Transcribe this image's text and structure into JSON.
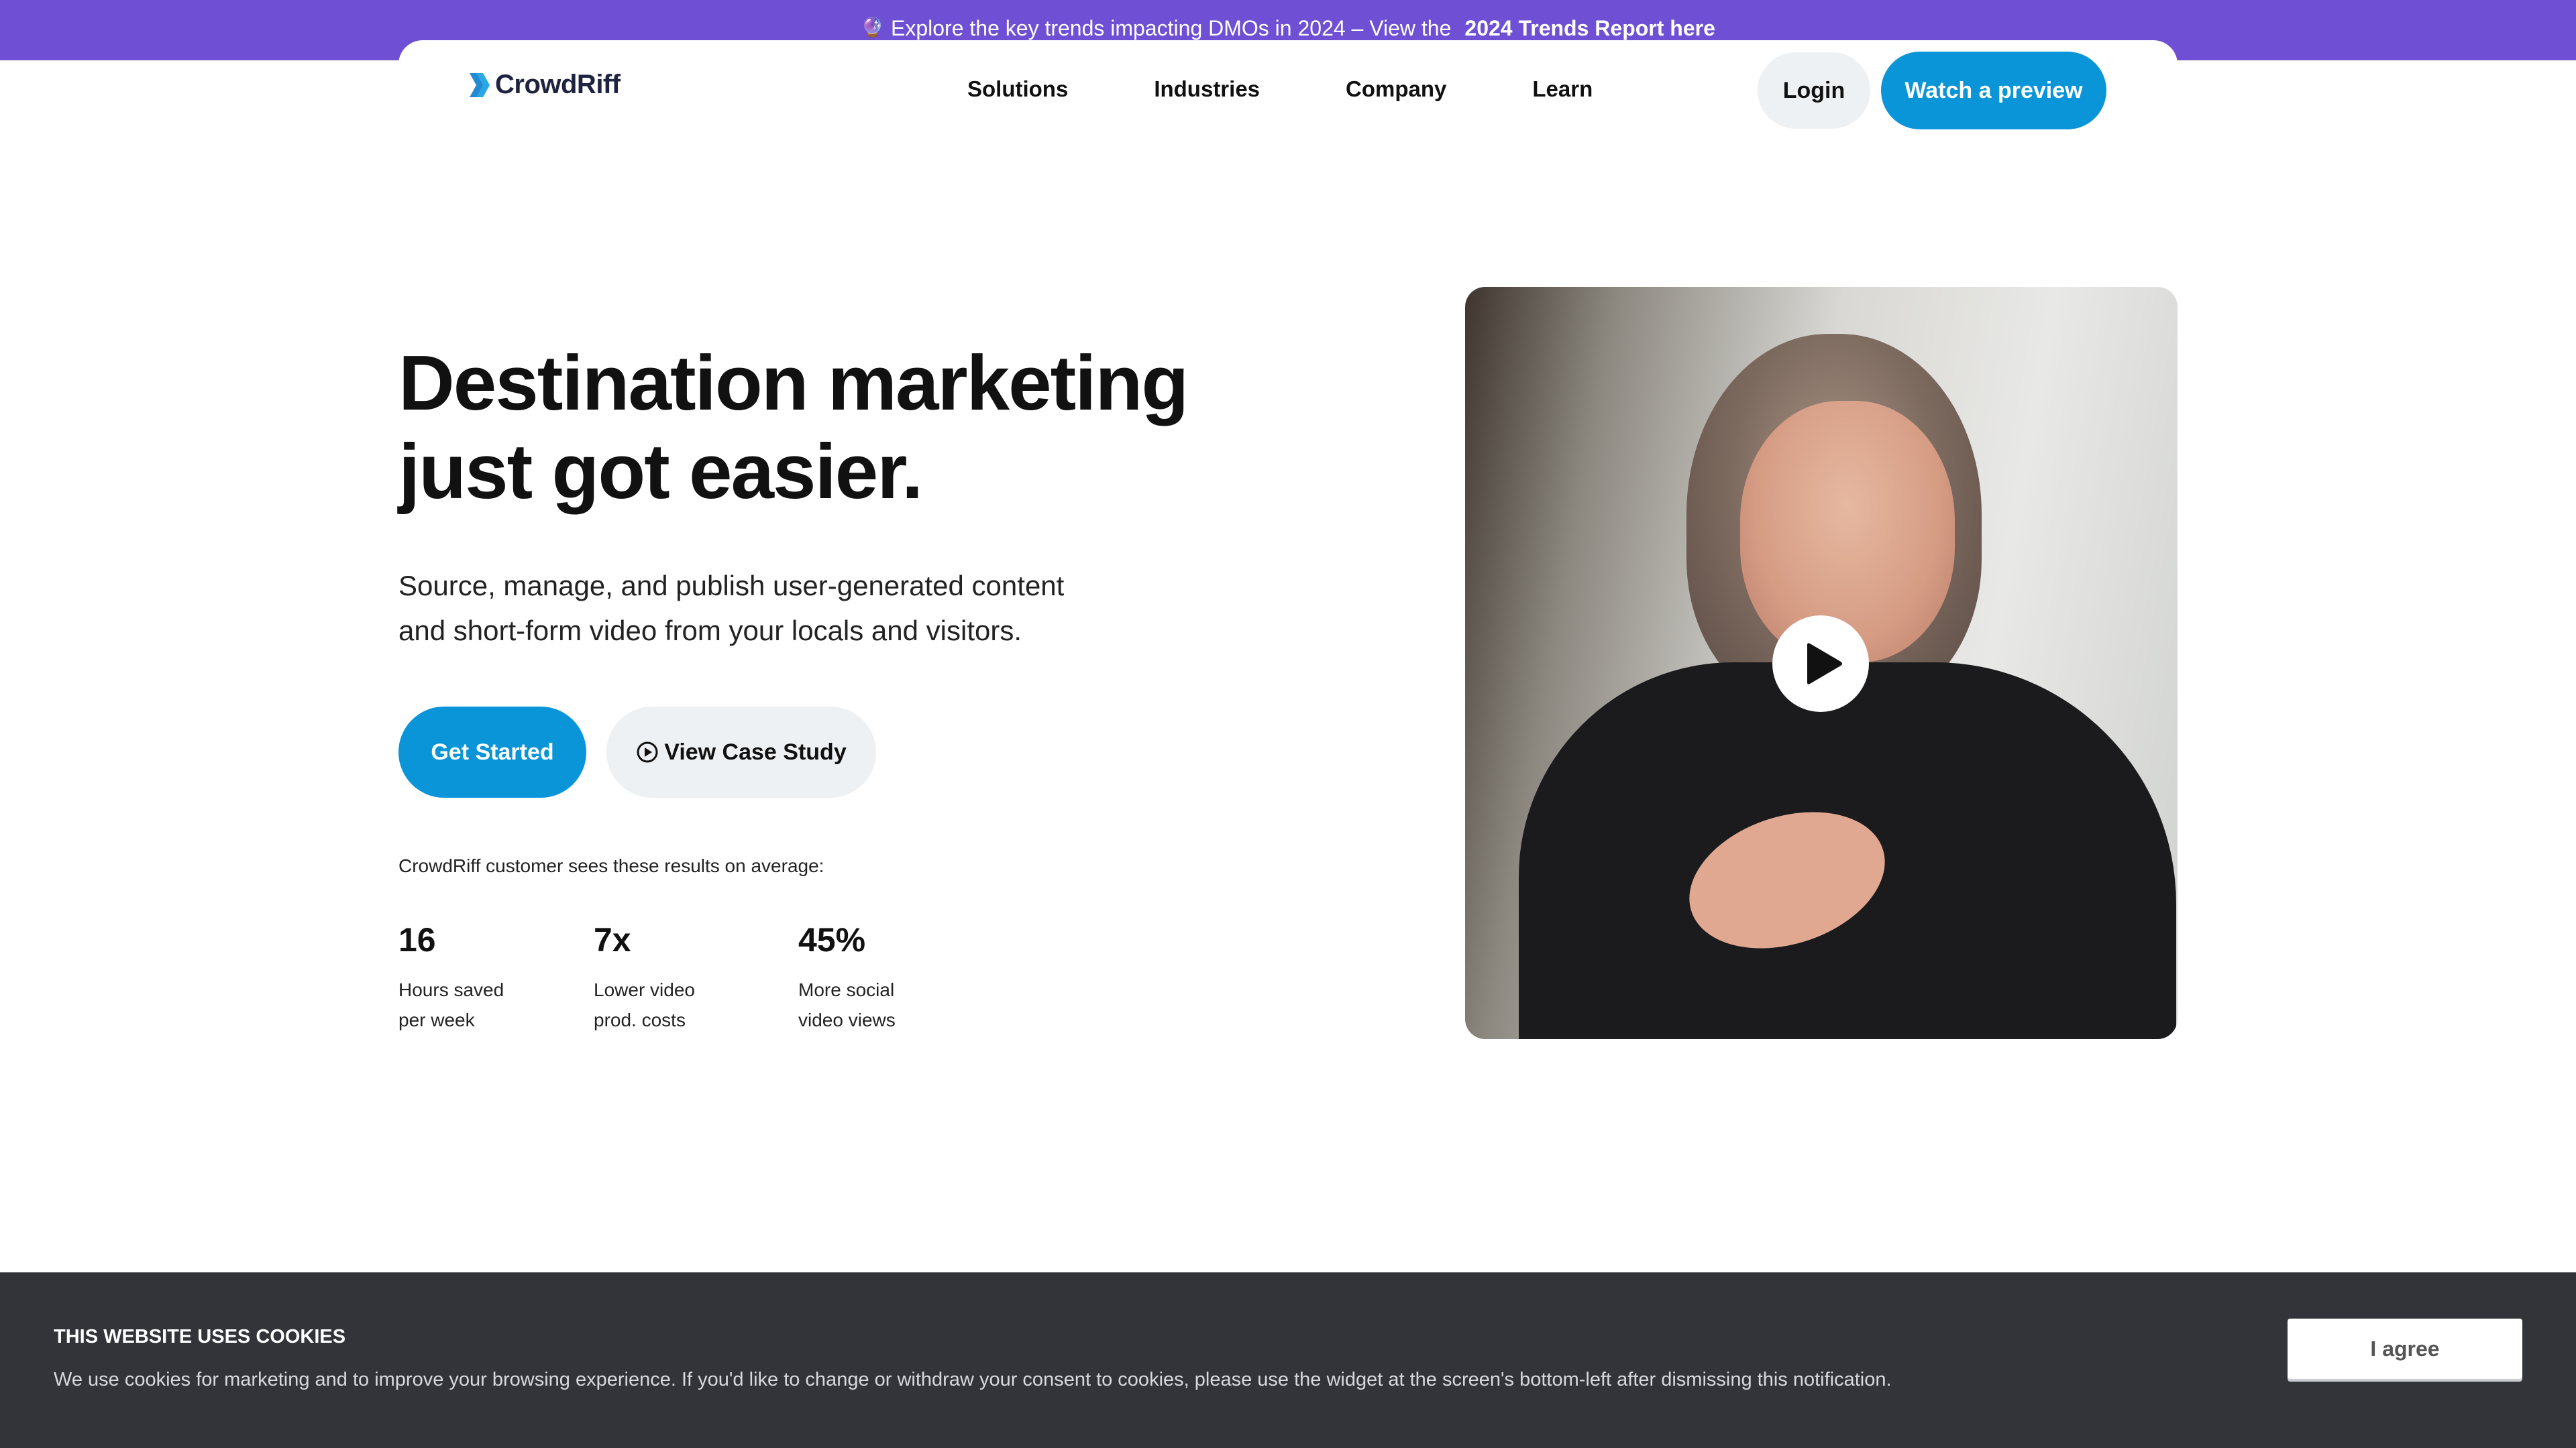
{
  "announcement": {
    "emoji": "🔮",
    "text": "Explore the key trends impacting DMOs in 2024 – View the",
    "link_text": "2024 Trends Report here"
  },
  "nav": {
    "logo_text": "CrowdRiff",
    "links": [
      "Solutions",
      "Industries",
      "Company",
      "Learn"
    ],
    "login_label": "Login",
    "preview_label": "Watch a preview"
  },
  "hero": {
    "title_line1": "Destination marketing",
    "title_line2": "just got easier.",
    "subtitle_line1": "Source, manage, and publish user-generated content",
    "subtitle_line2": "and short-form video from your locals and visitors.",
    "get_started_label": "Get Started",
    "case_study_label": "View Case Study",
    "results_intro": "CrowdRiff customer sees these results on average:",
    "stats": [
      {
        "value": "16",
        "label_line1": "Hours saved",
        "label_line2": "per week"
      },
      {
        "value": "7x",
        "label_line1": "Lower video",
        "label_line2": "prod. costs"
      },
      {
        "value": "45%",
        "label_line1": "More social",
        "label_line2": "video views"
      }
    ]
  },
  "cookie": {
    "title": "THIS WEBSITE USES COOKIES",
    "body": "We use cookies for marketing and to improve your browsing experience. If you'd like to change or withdraw your consent to cookies, please use the widget at the screen's bottom-left after dismissing this notification.",
    "agree_label": "I agree"
  },
  "colors": {
    "announcement_bg": "#6f4fd3",
    "accent_blue": "#0a95d8",
    "cookie_bg": "#333439"
  }
}
